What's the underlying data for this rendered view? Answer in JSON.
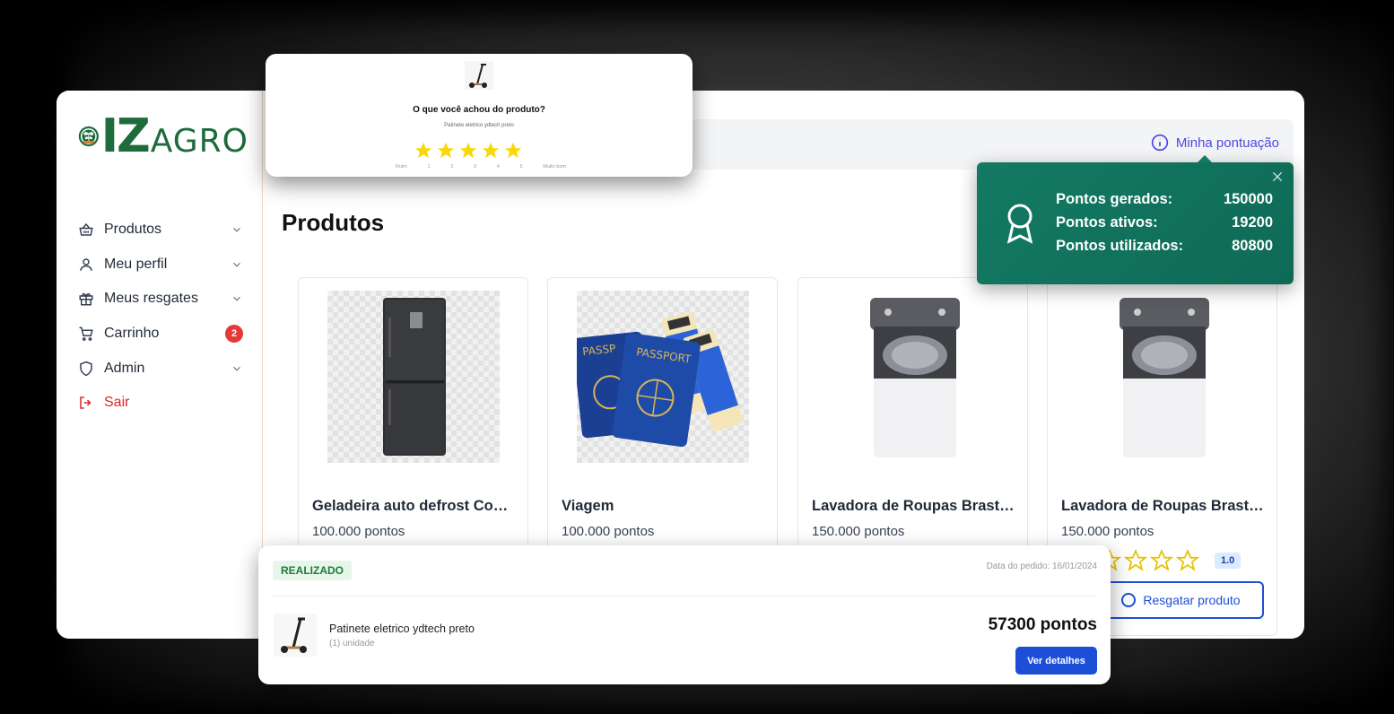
{
  "brand": {
    "logo_iz": "IZ",
    "logo_agro": "AGRO",
    "primary_green": "#1e6b3c"
  },
  "sidebar": {
    "items": [
      {
        "label": "Produtos",
        "icon": "basket-icon",
        "has_chevron": true
      },
      {
        "label": "Meu perfil",
        "icon": "user-icon",
        "has_chevron": true
      },
      {
        "label": "Meus resgates",
        "icon": "gift-icon",
        "has_chevron": true
      },
      {
        "label": "Carrinho",
        "icon": "cart-icon",
        "badge": "2"
      },
      {
        "label": "Admin",
        "icon": "shield-icon",
        "has_chevron": true
      },
      {
        "label": "Sair",
        "icon": "logout-icon"
      }
    ]
  },
  "header": {
    "points_link": "Minha pontuação"
  },
  "page": {
    "title": "Produtos"
  },
  "products": [
    {
      "name": "Geladeira auto defrost Cont...",
      "price": "100.000 pontos",
      "image": "refrigerator-image"
    },
    {
      "name": "Viagem",
      "price": "100.000 pontos",
      "image": "passports-image"
    },
    {
      "name": "Lavadora de Roupas Braste...",
      "price": "150.000 pontos",
      "image": "washing-machine-image"
    },
    {
      "name": "Lavadora de Roupas Braste...",
      "price": "150.000 pontos",
      "image": "washing-machine-image",
      "rating": "1.0",
      "stars_filled": 0,
      "stars_total": 5,
      "button": "Resgatar produto"
    }
  ],
  "points_popup": {
    "rows": [
      {
        "label": "Pontos gerados:",
        "value": "150000"
      },
      {
        "label": "Pontos ativos:",
        "value": "19200"
      },
      {
        "label": "Pontos utilizados:",
        "value": "80800"
      }
    ],
    "bg_color": "#137a63"
  },
  "review_popup": {
    "question": "O que você achou do produto?",
    "product": "Patinete eletrico ydtech preto",
    "stars_filled": 5,
    "scale": [
      "Ruim",
      "1",
      "2",
      "3",
      "4",
      "5",
      "Muito bom"
    ],
    "star_color": "#f5d90a"
  },
  "order_popup": {
    "status": "REALIZADO",
    "date": "Data do pedido: 16/01/2024",
    "product_name": "Patinete eletrico ydtech preto",
    "quantity": "(1) unidade",
    "points": "57300 pontos",
    "button": "Ver detalhes"
  }
}
